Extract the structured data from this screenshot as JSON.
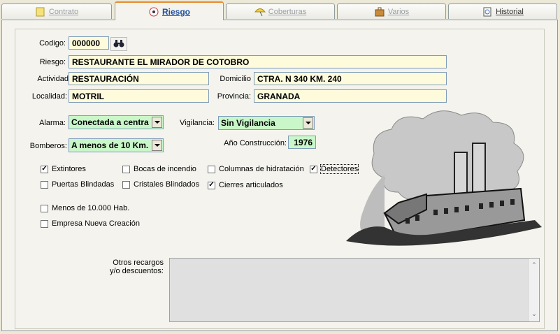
{
  "tabs": [
    {
      "label": "Contrato",
      "icon": "document-icon"
    },
    {
      "label": "Riesgo",
      "icon": "risk-icon"
    },
    {
      "label": "Coberturas",
      "icon": "umbrella-icon"
    },
    {
      "label": "Varios",
      "icon": "briefcase-icon"
    },
    {
      "label": "Historial",
      "icon": "history-icon"
    }
  ],
  "active_tab": "Riesgo",
  "form": {
    "codigo_label": "Codigo:",
    "codigo_value": "000000",
    "riesgo_label": "Riesgo:",
    "riesgo_value": "RESTAURANTE EL MIRADOR DE COTOBRO",
    "actividad_label": "Actividad",
    "actividad_value": "RESTAURACIÓN",
    "domicilio_label": "Domicilio",
    "domicilio_value": "CTRA. N 340 KM. 240",
    "localidad_label": "Localidad:",
    "localidad_value": "MOTRIL",
    "provincia_label": "Provincia:",
    "provincia_value": "GRANADA",
    "alarma_label": "Alarma:",
    "alarma_value": "Conectada a centra",
    "vigilancia_label": "Vigilancia:",
    "vigilancia_value": "Sin Vigilancia",
    "bomberos_label": "Bomberos:",
    "bomberos_value": "A menos de 10 Km.",
    "anio_label": "Año Construcción:",
    "anio_value": "1976"
  },
  "checkboxes": [
    {
      "label": "Extintores",
      "checked": true
    },
    {
      "label": "Bocas de incendio",
      "checked": false
    },
    {
      "label": "Columnas de hidratación",
      "checked": false
    },
    {
      "label": "Detectores",
      "checked": true
    },
    {
      "label": "Puertas Blindadas",
      "checked": false
    },
    {
      "label": "Cristales Blindados",
      "checked": false
    },
    {
      "label": "Cierres articulados",
      "checked": true
    },
    {
      "label": "Menos de 10.000 Hab.",
      "checked": false
    },
    {
      "label": "Empresa Nueva Creación",
      "checked": false
    }
  ],
  "otros": {
    "label_line1": "Otros recargos",
    "label_line2": "y/o descuentos:",
    "value": ""
  },
  "colors": {
    "field_yellow": "#fdfbdc",
    "field_green": "#c9f7c9",
    "active_tab_text": "#1f4fa0"
  }
}
